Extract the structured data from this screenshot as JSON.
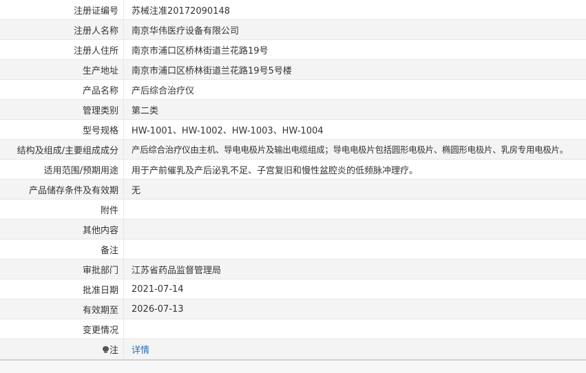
{
  "rows": [
    {
      "label": "注册证编号",
      "value": "苏械注准20172090148"
    },
    {
      "label": "注册人名称",
      "value": "南京华伟医疗设备有限公司"
    },
    {
      "label": "注册人住所",
      "value": "南京市浦口区桥林街道兰花路19号"
    },
    {
      "label": "生产地址",
      "value": "南京市浦口区桥林街道兰花路19号5号楼"
    },
    {
      "label": "产品名称",
      "value": "产后综合治疗仪"
    },
    {
      "label": "管理类别",
      "value": "第二类"
    },
    {
      "label": "型号规格",
      "value": "HW-1001、HW-1002、HW-1003、HW-1004"
    },
    {
      "label": "结构及组成/主要组成成分",
      "value": "产后综合治疗仪由主机、导电电极片及输出电缆组成；导电电极片包括圆形电极片、椭圆形电极片、乳房专用电极片。"
    },
    {
      "label": "适用范围/预期用途",
      "value": "用于产前催乳及产后泌乳不足、子宫复旧和慢性盆腔炎的低频脉冲理疗。"
    },
    {
      "label": "产品储存条件及有效期",
      "value": "无"
    },
    {
      "label": "附件",
      "value": ""
    },
    {
      "label": "其他内容",
      "value": ""
    },
    {
      "label": "备注",
      "value": ""
    },
    {
      "label": "审批部门",
      "value": "江苏省药品监督管理局"
    },
    {
      "label": "批准日期",
      "value": "2021-07-14"
    },
    {
      "label": "有效期至",
      "value": "2026-07-13"
    },
    {
      "label": "变更情况",
      "value": ""
    }
  ],
  "note": {
    "icon": "lightbulb-icon",
    "label": "注",
    "link_text": "详情",
    "link_color": "#2a6ebb"
  }
}
